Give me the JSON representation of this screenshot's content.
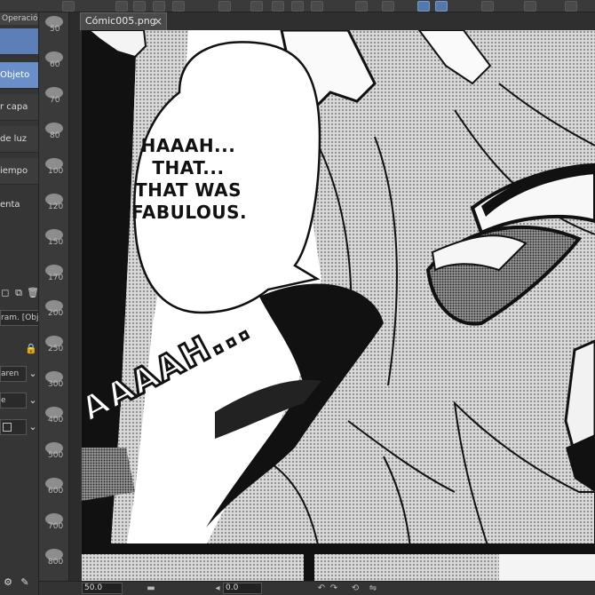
{
  "document": {
    "tab_title": "Cómic005.png",
    "close_glyph": "×"
  },
  "left_panel": {
    "tab_label": "Operació",
    "items": [
      "Objeto",
      "r capa",
      "de luz",
      "iempo",
      "enta"
    ],
    "layer_blend_text": "ram. [Obj",
    "dropdown_1": "aren",
    "dropdown_2": "e"
  },
  "brush_sizes": [
    "50",
    "60",
    "70",
    "80",
    "100",
    "120",
    "150",
    "170",
    "200",
    "250",
    "300",
    "400",
    "500",
    "600",
    "700",
    "800"
  ],
  "speech_bubble": {
    "lines": [
      "HAAAH...",
      "THAT...",
      "THAT WAS",
      "FABULOUS."
    ]
  },
  "sfx_text": "AAAAH...",
  "status_bar": {
    "zoom": "50.0",
    "angle": "0.0"
  },
  "icons": {
    "new-layer": "new-layer-icon",
    "copy-layer": "copy-layer-icon",
    "trash": "trash-icon",
    "lock": "lock-icon",
    "close": "close-icon"
  }
}
